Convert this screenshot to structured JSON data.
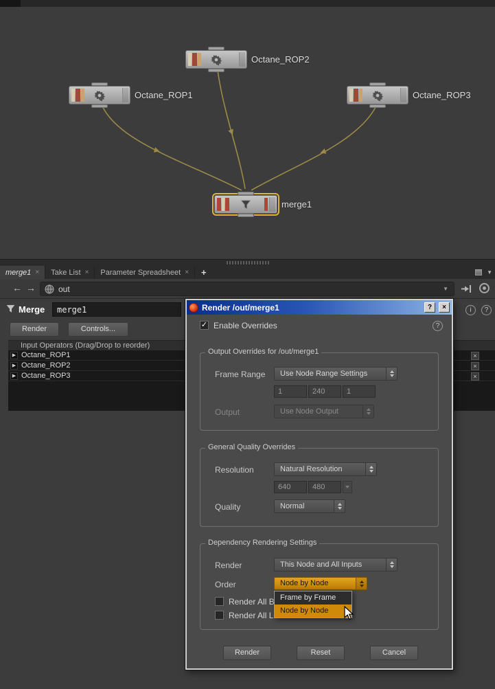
{
  "icons": {
    "close": "×",
    "help": "?",
    "info": "i",
    "add_tab": "+",
    "back_arrow": "←",
    "forward_arrow": "→",
    "dropdown_arrow": "▼",
    "check": "✓",
    "row_glyph": "▶"
  },
  "colors": {
    "selection_yellow": "#e0b63a",
    "accent_orange": "#cf8a0a",
    "wire": "#9c8a46",
    "titlebar_blue": "#0b2e8e"
  },
  "network": {
    "nodes": [
      {
        "label": "Octane_ROP2"
      },
      {
        "label": "Octane_ROP1"
      },
      {
        "label": "Octane_ROP3"
      },
      {
        "label": "merge1"
      }
    ]
  },
  "tabs": {
    "items": [
      "merge1",
      "Take List",
      "Parameter Spreadsheet"
    ]
  },
  "pathbar": {
    "path": "out"
  },
  "panel": {
    "node_type": "Merge",
    "name_value": "merge1",
    "render_button": "Render",
    "controls_button": "Controls...",
    "list_header": "Input Operators (Drag/Drop to reorder)",
    "rows": [
      "Octane_ROP1",
      "Octane_ROP2",
      "Octane_ROP3"
    ]
  },
  "dialog": {
    "title": "Render /out/merge1",
    "enable_overrides": "Enable Overrides",
    "output_group": {
      "title": "Output Overrides for /out/merge1",
      "frame_range_label": "Frame Range",
      "frame_range_value": "Use Node Range Settings",
      "frame_start": "1",
      "frame_end": "240",
      "frame_inc": "1",
      "output_label": "Output",
      "output_value": "Use Node Output"
    },
    "quality_group": {
      "title": "General Quality Overrides",
      "resolution_label": "Resolution",
      "resolution_value": "Natural Resolution",
      "res_x": "640",
      "res_y": "480",
      "quality_label": "Quality",
      "quality_value": "Normal"
    },
    "dependency_group": {
      "title": "Dependency Rendering Settings",
      "render_label": "Render",
      "render_value": "This Node and All Inputs",
      "order_label": "Order",
      "order_value": "Node by Node",
      "checkbox1": "Render All B",
      "checkbox2": "Render All Locked Nodes"
    },
    "order_menu": {
      "items": [
        "Frame by Frame",
        "Node by Node"
      ]
    },
    "buttons": {
      "render": "Render",
      "reset": "Reset",
      "cancel": "Cancel"
    }
  }
}
